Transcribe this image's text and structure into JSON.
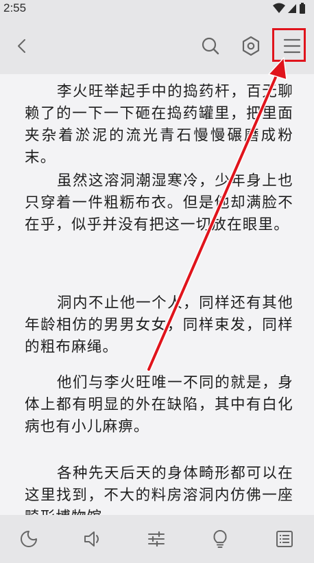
{
  "status_bar": {
    "time": "2:55",
    "icons": [
      "wifi-icon",
      "cellular-signal-icon",
      "battery-icon"
    ]
  },
  "toolbar": {
    "back_icon": "chevron-left-icon",
    "search_icon": "search-icon",
    "settings_icon": "hexagon-settings-icon",
    "menu_icon": "hamburger-menu-icon"
  },
  "content": {
    "paragraphs": [
      "李火旺举起手中的捣药杆，百无聊赖了的一下一下砸在捣药罐里，把里面夹杂着淤泥的流光青石慢慢碾磨成粉末。",
      "虽然这溶洞潮湿寒冷，少年身上也只穿着一件粗粝布衣。但是他却满脸不在乎，似乎并没有把这一切放在眼里。",
      "洞内不止他一个人，同样还有其他年龄相仿的男男女女，同样束发，同样的粗布麻绳。",
      "他们与李火旺唯一不同的就是，身体上都有明显的外在缺陷，其中有白化病也有小儿麻痹。",
      "各种先天后天的身体畸形都可以在这里找到，不大的料房溶洞内仿佛一座畸形博物馆。"
    ]
  },
  "bottom_bar": {
    "icons": [
      "night-mode-moon-icon",
      "speaker-read-aloud-icon",
      "sliders-settings-icon",
      "lightbulb-icon",
      "table-of-contents-icon"
    ]
  },
  "annotation": {
    "highlight_color": "#e0141c",
    "target": "hamburger-menu-icon"
  }
}
